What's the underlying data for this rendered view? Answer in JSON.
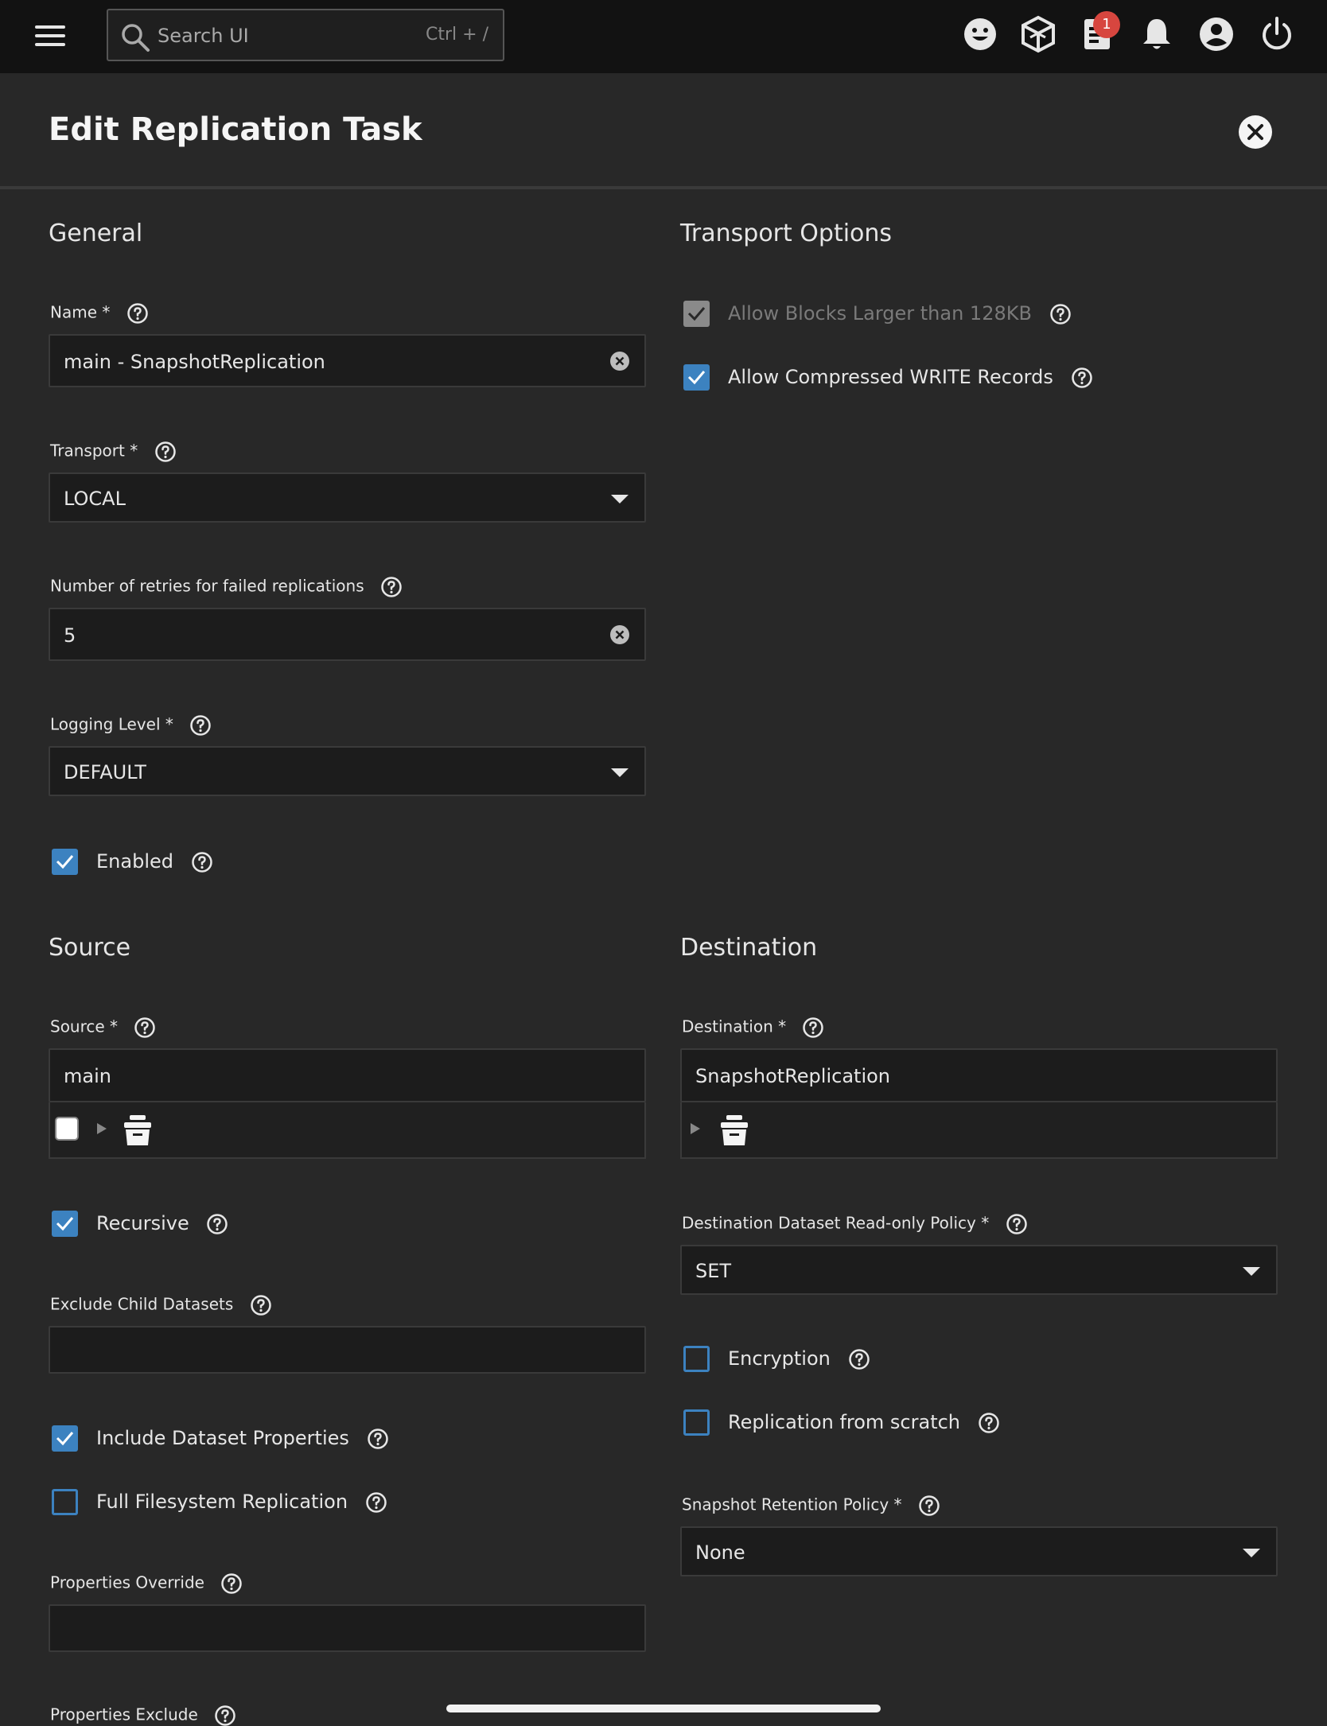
{
  "topbar": {
    "search_placeholder": "Search UI",
    "search_shortcut": "Ctrl + /",
    "tasks_badge": "1"
  },
  "header": {
    "title": "Edit Replication Task"
  },
  "general": {
    "title": "General",
    "name_label": "Name *",
    "name_value": "main - SnapshotReplication",
    "transport_label": "Transport *",
    "transport_value": "LOCAL",
    "retries_label": "Number of retries for failed replications",
    "retries_value": "5",
    "logging_label": "Logging Level *",
    "logging_value": "DEFAULT",
    "enabled_label": "Enabled"
  },
  "transport_options": {
    "title": "Transport Options",
    "allow_blocks_label": "Allow Blocks Larger than 128KB",
    "allow_compressed_label": "Allow Compressed WRITE Records"
  },
  "source": {
    "title": "Source",
    "source_label": "Source *",
    "source_value": "main",
    "recursive_label": "Recursive",
    "exclude_label": "Exclude Child Datasets",
    "include_props_label": "Include Dataset Properties",
    "full_fs_label": "Full Filesystem Replication",
    "props_override_label": "Properties Override",
    "props_exclude_label": "Properties Exclude"
  },
  "destination": {
    "title": "Destination",
    "destination_label": "Destination *",
    "destination_value": "SnapshotReplication",
    "readonly_label": "Destination Dataset Read-only Policy *",
    "readonly_value": "SET",
    "encryption_label": "Encryption",
    "scratch_label": "Replication from scratch",
    "retention_label": "Snapshot Retention Policy *",
    "retention_value": "None"
  },
  "colors": {
    "accent": "#3c82c0",
    "badge": "#d7463f",
    "topbar": "#121212",
    "background": "#282828"
  }
}
